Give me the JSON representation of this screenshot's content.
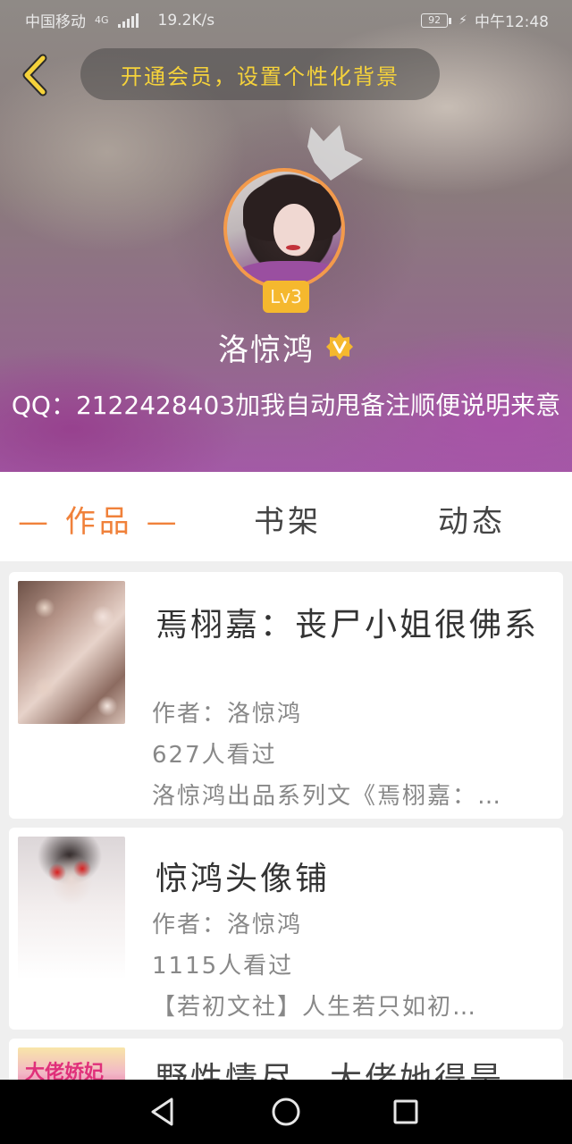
{
  "status_bar": {
    "carrier": "中国移动",
    "network": "4G",
    "speed": "19.2K/s",
    "battery": "92",
    "time": "中午12:48"
  },
  "header": {
    "vip_promo": "开通会员，设置个性化背景",
    "level": "Lv3",
    "username": "洛惊鸿",
    "bio": "QQ：2122428403加我自动甩备注顺便说明来意"
  },
  "tabs": [
    {
      "label": "— 作品 —",
      "active": true
    },
    {
      "label": "书架",
      "active": false
    },
    {
      "label": "动态",
      "active": false
    }
  ],
  "works": [
    {
      "title": "焉栩嘉：丧尸小姐很佛系",
      "author": "作者：洛惊鸿",
      "views": "627人看过",
      "desc": "洛惊鸿出品系列文《焉栩嘉：…"
    },
    {
      "title": "惊鸿头像铺",
      "author": "作者：洛惊鸿",
      "views": "1115人看过",
      "desc": "【若初文社】人生若只如初…"
    },
    {
      "title": "野性情尽，大佬她得是…",
      "thumb_text": "大佬娇妃"
    }
  ],
  "colors": {
    "accent": "#f0813a",
    "vip_text": "#f5d23b",
    "level_badge": "#f5b82e"
  },
  "icons": {
    "back": "chevron-left-icon",
    "crown": "crown-icon",
    "verified": "verified-v-icon",
    "nav_back": "triangle-back-icon",
    "nav_home": "circle-home-icon",
    "nav_recent": "square-recent-icon"
  }
}
